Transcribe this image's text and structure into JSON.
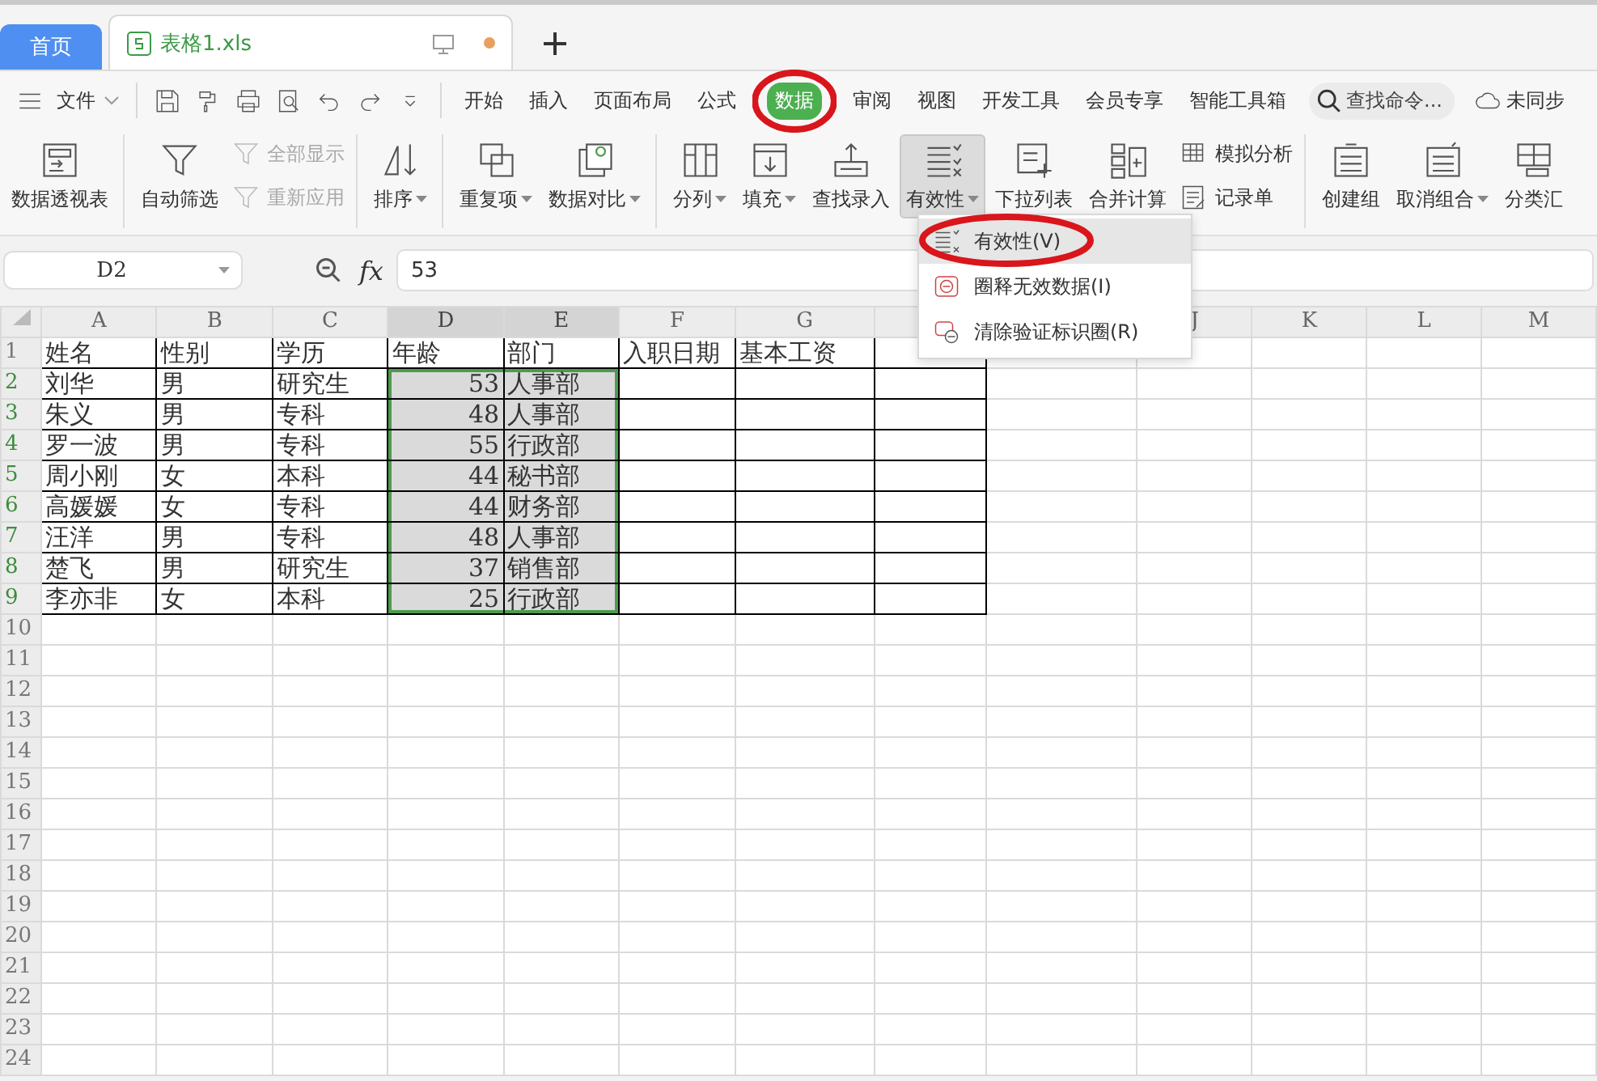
{
  "tabs": [
    {
      "label": "首页",
      "kind": "home",
      "selected": false
    },
    {
      "label": "表格1.xls",
      "kind": "file",
      "selected": true,
      "unsaved": true
    }
  ],
  "menu": {
    "file_label": "文件",
    "items": [
      {
        "label": "开始",
        "selected": false
      },
      {
        "label": "插入",
        "selected": false
      },
      {
        "label": "页面布局",
        "selected": false
      },
      {
        "label": "公式",
        "selected": false
      },
      {
        "label": "数据",
        "selected": true
      },
      {
        "label": "审阅",
        "selected": false
      },
      {
        "label": "视图",
        "selected": false
      },
      {
        "label": "开发工具",
        "selected": false
      },
      {
        "label": "会员专享",
        "selected": false
      },
      {
        "label": "智能工具箱",
        "selected": false
      }
    ],
    "search_placeholder": "查找命令...",
    "sync": "未同步"
  },
  "ribbon": {
    "groups": [
      [
        {
          "label": "数据透视表",
          "kind": "large",
          "caret": false,
          "pressed": false,
          "disabled": false
        }
      ],
      [
        {
          "label": "自动筛选",
          "kind": "large",
          "caret": false,
          "pressed": false,
          "disabled": false
        },
        {
          "label": "全部显示",
          "kind": "small",
          "caret": false,
          "pressed": false,
          "disabled": true
        },
        {
          "label": "重新应用",
          "kind": "small",
          "caret": false,
          "pressed": false,
          "disabled": true
        }
      ],
      [
        {
          "label": "排序",
          "kind": "large",
          "caret": true,
          "pressed": false,
          "disabled": false
        }
      ],
      [
        {
          "label": "重复项",
          "kind": "large",
          "caret": true,
          "pressed": false,
          "disabled": false
        },
        {
          "label": "数据对比",
          "kind": "large",
          "caret": true,
          "pressed": false,
          "disabled": false
        }
      ],
      [
        {
          "label": "分列",
          "kind": "large",
          "caret": true,
          "pressed": false,
          "disabled": false
        },
        {
          "label": "填充",
          "kind": "large",
          "caret": true,
          "pressed": false,
          "disabled": false
        },
        {
          "label": "查找录入",
          "kind": "large",
          "caret": false,
          "pressed": false,
          "disabled": false
        },
        {
          "label": "有效性",
          "kind": "large",
          "caret": true,
          "pressed": true,
          "disabled": false
        },
        {
          "label": "下拉列表",
          "kind": "large",
          "caret": false,
          "pressed": false,
          "disabled": false
        },
        {
          "label": "合并计算",
          "kind": "large",
          "caret": false,
          "pressed": false,
          "disabled": false
        },
        {
          "label": "模拟分析",
          "kind": "small",
          "caret": false,
          "pressed": false,
          "disabled": false
        },
        {
          "label": "记录单",
          "kind": "small",
          "caret": false,
          "pressed": false,
          "disabled": false
        }
      ],
      [
        {
          "label": "创建组",
          "kind": "large",
          "caret": false,
          "pressed": false,
          "disabled": false
        },
        {
          "label": "取消组合",
          "kind": "large",
          "caret": true,
          "pressed": false,
          "disabled": false
        },
        {
          "label": "分类汇",
          "kind": "large",
          "caret": false,
          "pressed": false,
          "disabled": false
        }
      ]
    ]
  },
  "dropdown": [
    {
      "label": "有效性(V)",
      "selected": true
    },
    {
      "label": "圈释无效数据(I)",
      "selected": false
    },
    {
      "label": "清除验证标识圈(R)",
      "selected": false
    }
  ],
  "formula_bar": {
    "name_box": "D2",
    "function_label": "fx",
    "formula": "53"
  },
  "sheet": {
    "columns": [
      {
        "letter": "A",
        "selected": false
      },
      {
        "letter": "B",
        "selected": false
      },
      {
        "letter": "C",
        "selected": false
      },
      {
        "letter": "D",
        "selected": true,
        "numeric": true
      },
      {
        "letter": "E",
        "selected": true
      },
      {
        "letter": "F",
        "selected": false
      },
      {
        "letter": "G",
        "selected": false
      },
      {},
      {},
      {
        "letter": "J",
        "selected": false
      },
      {
        "letter": "K",
        "selected": false
      },
      {
        "letter": "L",
        "selected": false
      },
      {
        "letter": "M",
        "selected": false
      }
    ],
    "rows": [
      {
        "number": "1",
        "selected": false,
        "cells": [
          "姓名",
          "性别",
          "学历",
          "年龄",
          "部门",
          "入职日期",
          "基本工资"
        ]
      },
      {
        "number": "2",
        "selected": true,
        "cells": [
          "刘华",
          "男",
          "研究生",
          "53",
          "人事部"
        ]
      },
      {
        "number": "3",
        "selected": true,
        "cells": [
          "朱义",
          "男",
          "专科",
          "48",
          "人事部"
        ]
      },
      {
        "number": "4",
        "selected": true,
        "cells": [
          "罗一波",
          "男",
          "专科",
          "55",
          "行政部"
        ]
      },
      {
        "number": "5",
        "selected": true,
        "cells": [
          "周小刚",
          "女",
          "本科",
          "44",
          "秘书部"
        ]
      },
      {
        "number": "6",
        "selected": true,
        "cells": [
          "高媛媛",
          "女",
          "专科",
          "44",
          "财务部"
        ]
      },
      {
        "number": "7",
        "selected": true,
        "cells": [
          "汪洋",
          "男",
          "专科",
          "48",
          "人事部"
        ]
      },
      {
        "number": "8",
        "selected": true,
        "cells": [
          "楚飞",
          "男",
          "研究生",
          "37",
          "销售部"
        ]
      },
      {
        "number": "9",
        "selected": true,
        "cells": [
          "李亦非",
          "女",
          "本科",
          "25",
          "行政部"
        ]
      },
      {
        "number": "10",
        "selected": false
      },
      {
        "number": "11",
        "selected": false
      },
      {
        "number": "12",
        "selected": false
      },
      {
        "number": "13",
        "selected": false
      },
      {
        "number": "14",
        "selected": false
      },
      {
        "number": "15",
        "selected": false
      },
      {
        "number": "16",
        "selected": false
      },
      {
        "number": "17",
        "selected": false
      },
      {
        "number": "18",
        "selected": false
      },
      {
        "number": "19",
        "selected": false
      },
      {
        "number": "20",
        "selected": false
      },
      {
        "number": "21",
        "selected": false
      },
      {
        "number": "22",
        "selected": false
      },
      {
        "number": "23",
        "selected": false
      },
      {
        "number": "24",
        "selected": false
      }
    ]
  }
}
